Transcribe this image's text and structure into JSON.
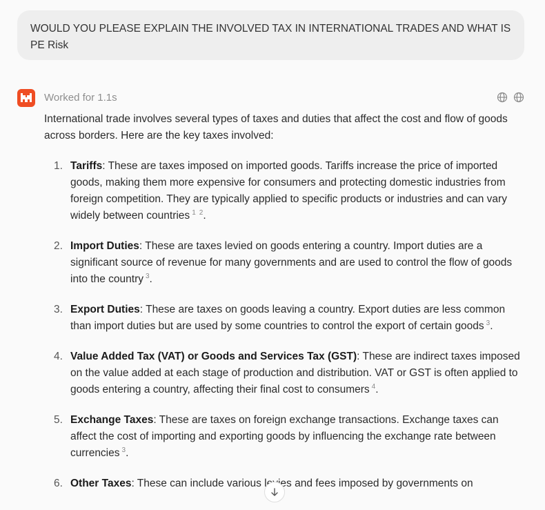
{
  "user_message": {
    "text": "WOULD YOU PLEASE EXPLAIN THE INVOLVED TAX IN INTERNATIONAL TRADES AND WHAT IS PE Risk"
  },
  "assistant": {
    "avatar_icon": "brand-logo-icon",
    "avatar_color": "#ef4d23",
    "worked_label": "Worked for 1.1s",
    "header_icons": [
      "globe-icon",
      "globe-icon"
    ],
    "intro": "International trade involves several types of taxes and duties that affect the cost and flow of goods across borders. Here are the key taxes involved:",
    "items": [
      {
        "number": "1.",
        "term": "Tariffs",
        "text": ": These are taxes imposed on imported goods. Tariffs increase the price of imported goods, making them more expensive for consumers and protecting domestic industries from foreign competition. They are typically applied to specific products or industries and can vary widely between countries",
        "citations": [
          "1",
          "2"
        ],
        "end": "."
      },
      {
        "number": "2.",
        "term": "Import Duties",
        "text": ": These are taxes levied on goods entering a country. Import duties are a significant source of revenue for many governments and are used to control the flow of goods into the country",
        "citations": [
          "3"
        ],
        "end": "."
      },
      {
        "number": "3.",
        "term": "Export Duties",
        "text": ": These are taxes on goods leaving a country. Export duties are less common than import duties but are used by some countries to control the export of certain goods",
        "citations": [
          "3"
        ],
        "end": "."
      },
      {
        "number": "4.",
        "term": "Value Added Tax (VAT) or Goods and Services Tax (GST)",
        "text": ": These are indirect taxes imposed on the value added at each stage of production and distribution. VAT or GST is often applied to goods entering a country, affecting their final cost to consumers",
        "citations": [
          "4"
        ],
        "end": "."
      },
      {
        "number": "5.",
        "term": "Exchange Taxes",
        "text": ": These are taxes on foreign exchange transactions. Exchange taxes can affect the cost of importing and exporting goods by influencing the exchange rate between currencies",
        "citations": [
          "3"
        ],
        "end": "."
      },
      {
        "number": "6.",
        "term": "Other Taxes",
        "text": ": These can include various levies and fees imposed by governments on",
        "citations": [],
        "end": ""
      }
    ]
  },
  "scroll_button": {
    "icon": "arrow-down-icon"
  }
}
